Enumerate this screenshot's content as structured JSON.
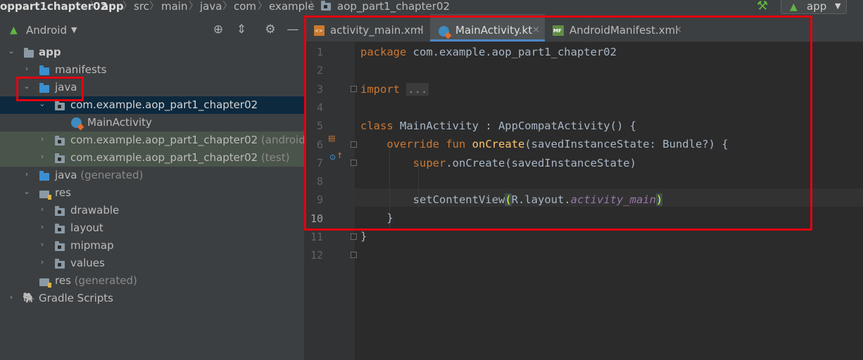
{
  "breadcrumb": {
    "project": "oppart1chapter02",
    "module": "app",
    "items": [
      "src",
      "main",
      "java",
      "com",
      "example",
      "aop_part1_chapter02"
    ]
  },
  "toolbar": {
    "build_icon": "hammer-icon",
    "run_config_label": "app"
  },
  "project_panel": {
    "view_label": "Android",
    "tools": [
      "locate-icon",
      "collapse-icon",
      "gear-icon",
      "minimize-icon"
    ],
    "tree": [
      {
        "label": "app",
        "bold": true
      },
      {
        "label": "manifests"
      },
      {
        "label": "java"
      },
      {
        "label": "com.example.aop_part1_chapter02"
      },
      {
        "label": "MainActivity"
      },
      {
        "label": "com.example.aop_part1_chapter02",
        "suffix": "(androidTest)"
      },
      {
        "label": "com.example.aop_part1_chapter02",
        "suffix": "(test)"
      },
      {
        "label": "java",
        "suffix": "(generated)"
      },
      {
        "label": "res"
      },
      {
        "label": "drawable"
      },
      {
        "label": "layout"
      },
      {
        "label": "mipmap"
      },
      {
        "label": "values"
      },
      {
        "label": "res",
        "suffix": "(generated)"
      },
      {
        "label": "Gradle Scripts"
      }
    ]
  },
  "editor": {
    "tabs": [
      {
        "label": "activity_main.xml",
        "close": "×"
      },
      {
        "label": "MainActivity.kt",
        "close": "×",
        "active": true
      },
      {
        "label": "AndroidManifest.xml",
        "close": "×"
      }
    ],
    "line_numbers": [
      "1",
      "2",
      "3",
      "4",
      "5",
      "6",
      "7",
      "8",
      "9",
      "10",
      "11",
      "12"
    ],
    "current_line": "10",
    "code": {
      "l1_kw": "package",
      "l1_rest": " com.example.aop_part1_chapter02",
      "l3_kw": "import",
      "l3_fold": "...",
      "l6_kw": "class",
      "l6_rest": " MainActivity : AppCompatActivity() {",
      "l7_indent": "    ",
      "l7_kw1": "override",
      "l7_kw2": "fun",
      "l7_fn": "onCreate",
      "l7_rest": "(savedInstanceState: Bundle?) {",
      "l8_indent": "        ",
      "l8_kw": "super",
      "l8_rest": ".onCreate(savedInstanceState)",
      "l10_indent": "        ",
      "l10_a": "setContentView",
      "l10_paren_open": "(",
      "l10_b": "R.layout.",
      "l10_it": "activity_main",
      "l10_paren_close": ")",
      "l11": "    }",
      "l12": "}"
    }
  },
  "colors": {
    "highlight_border": "#e3000f",
    "selection": "#0d293e",
    "keyword": "#cc7832",
    "function": "#ffc66d"
  }
}
